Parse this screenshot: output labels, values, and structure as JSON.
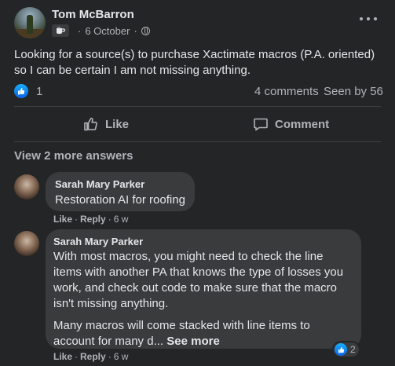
{
  "post": {
    "author": "Tom McBarron",
    "date": "6 October",
    "text": "Looking for a source(s) to purchase Xactimate macros (P.A. oriented) so I can be certain I am not missing anything.",
    "reaction_count": "1",
    "comments_label": "4 comments",
    "seen_label": "Seen by 56",
    "like_label": "Like",
    "comment_label": "Comment"
  },
  "view_more": "View 2 more answers",
  "comments": [
    {
      "name": "Sarah Mary Parker",
      "text": "Restoration AI for roofing",
      "like": "Like",
      "reply": "Reply",
      "time": "6 w"
    },
    {
      "name": "Sarah Mary Parker",
      "paragraph1": "With most macros, you might need to check the line items with another PA that knows the type of losses you work, and check out code to make sure that the macro isn't missing anything.",
      "paragraph2": "Many macros will come stacked with line items to account for many d...",
      "see_more": "See more",
      "like": "Like",
      "reply": "Reply",
      "time": "6 w",
      "reaction_count": "2"
    }
  ],
  "colors": {
    "background": "#242526",
    "bubble": "#3a3b3c",
    "text_primary": "#e4e6eb",
    "text_secondary": "#b0b3b8",
    "like_blue": "#0a64e6"
  }
}
